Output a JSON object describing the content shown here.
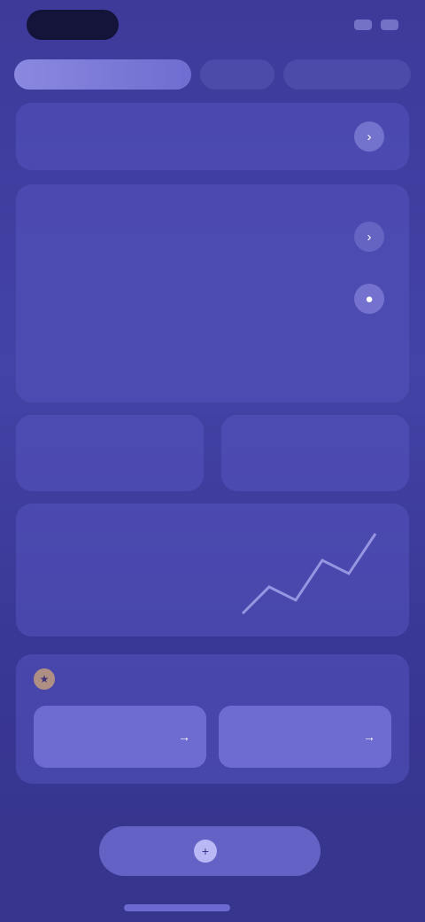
{
  "tabs": [
    {
      "label": ""
    },
    {
      "label": ""
    },
    {
      "label": ""
    }
  ],
  "summary": {
    "label": "",
    "action_icon": "chevron-right-icon"
  },
  "main": {
    "rows": [
      {
        "sub": "",
        "label": "",
        "icon": "chevron-right-icon"
      },
      {
        "sub": "",
        "label": "",
        "icon": "toggle-icon"
      }
    ],
    "note": ""
  },
  "half_cards": [
    {
      "value": ""
    },
    {
      "value": ""
    }
  ],
  "stats": {
    "title": "",
    "big": "",
    "small": "",
    "foot": "",
    "spark_values": [
      3,
      5,
      4,
      7,
      6,
      9
    ]
  },
  "feature": {
    "badge_icon": "star-icon",
    "buttons": [
      {
        "label": "",
        "icon": "arrow-right-icon"
      },
      {
        "label": "",
        "icon": "arrow-right-icon"
      }
    ]
  },
  "cta": {
    "label": "",
    "icon": "plus-icon"
  }
}
